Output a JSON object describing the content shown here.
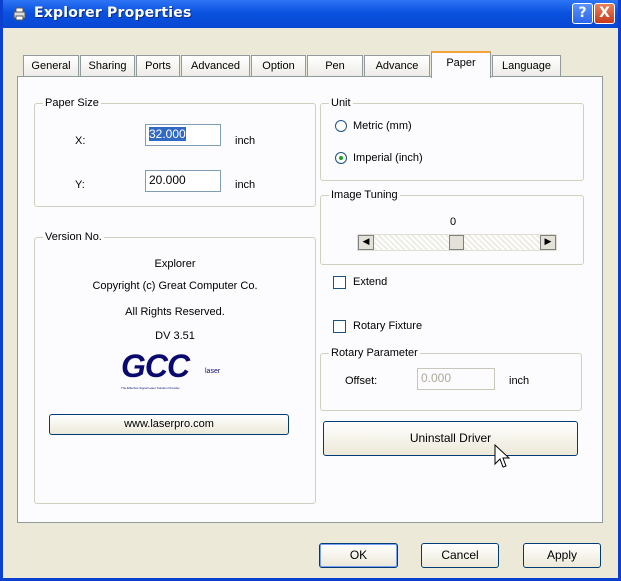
{
  "window": {
    "title": "Explorer Properties",
    "help_label": "?",
    "close_label": "X"
  },
  "tabs": [
    "General",
    "Sharing",
    "Ports",
    "Advanced",
    "Option",
    "Pen",
    "Advance",
    "Paper",
    "Language"
  ],
  "active_tab": "Paper",
  "paper_size": {
    "title": "Paper Size",
    "x_label": "X:",
    "x_value": "32.000",
    "x_unit": "inch",
    "y_label": "Y:",
    "y_value": "20.000",
    "y_unit": "inch"
  },
  "version": {
    "title": "Version No.",
    "product": "Explorer",
    "copyright": "Copyright (c) Great Computer Co.",
    "rights": "All Rights Reserved.",
    "dv": "DV 3.51",
    "logo_text": "GCC",
    "logo_small": "laser",
    "logo_tagline": "The Effective Signal Laser Solution Provider",
    "website": "www.laserpro.com"
  },
  "unit": {
    "title": "Unit",
    "metric_label": "Metric (mm)",
    "imperial_label": "Imperial (inch)",
    "selected": "imperial"
  },
  "image_tuning": {
    "title": "Image Tuning",
    "value": "0",
    "left_arrow": "◀",
    "right_arrow": "▶"
  },
  "extend": {
    "label": "Extend",
    "checked": false
  },
  "rotary_fixture": {
    "label": "Rotary Fixture",
    "checked": false
  },
  "rotary_param": {
    "title": "Rotary Parameter",
    "offset_label": "Offset:",
    "offset_value": "0.000",
    "offset_unit": "inch"
  },
  "uninstall_label": "Uninstall Driver",
  "footer": {
    "ok_label": "OK",
    "cancel_label": "Cancel",
    "apply_label": "Apply"
  },
  "colors": {
    "titlebar": "#0a52e0",
    "active_tab_accent": "#f2a43a",
    "selection": "#316ac5",
    "face": "#ece9d8"
  }
}
